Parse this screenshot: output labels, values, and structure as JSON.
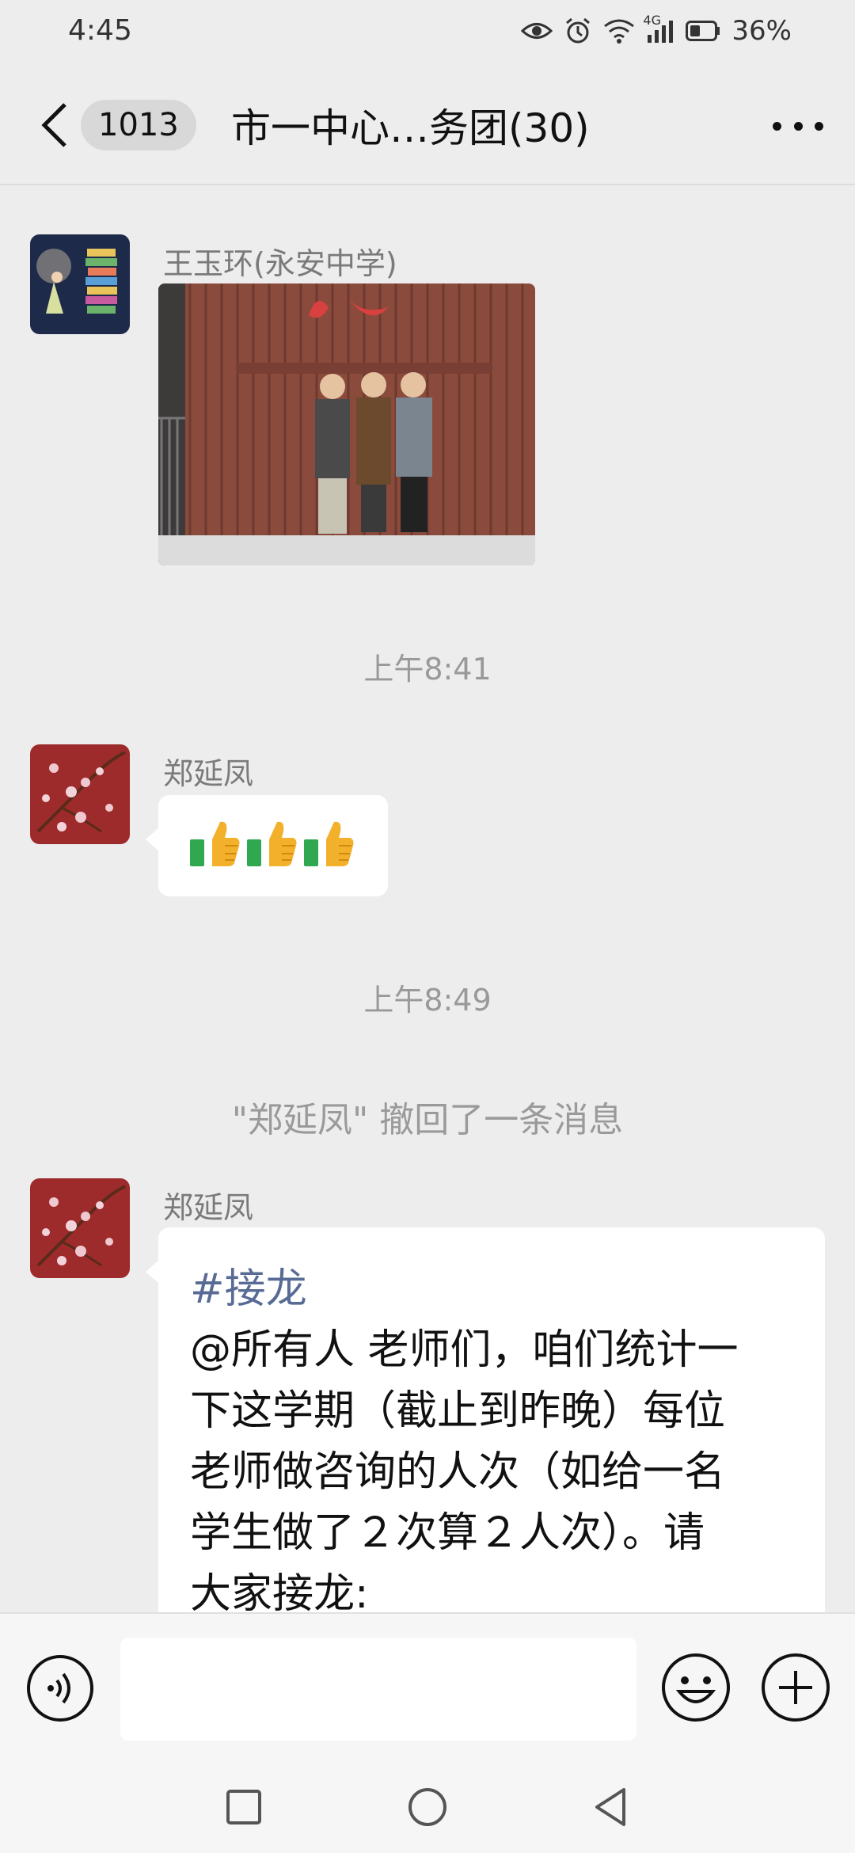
{
  "status_bar": {
    "time": "4:45",
    "network": "4G",
    "battery": "36%",
    "icons": [
      "eye-icon",
      "alarm-icon",
      "wifi-icon",
      "signal-icon",
      "battery-icon"
    ]
  },
  "header": {
    "back_icon": "chevron-left-icon",
    "unread_count": "1013",
    "title": "市一中心…务团(30)",
    "more_icon": "more-icon"
  },
  "messages": [
    {
      "type": "image",
      "sender": "王玉环(永安中学)",
      "content_icon": "photo-image"
    },
    {
      "type": "timestamp",
      "text": "上午8:41"
    },
    {
      "type": "emoji",
      "sender": "郑延凤",
      "emoji": [
        "thumbs-up-icon",
        "thumbs-up-icon",
        "thumbs-up-icon"
      ]
    },
    {
      "type": "timestamp",
      "text": "上午8:49"
    },
    {
      "type": "system",
      "text": "\"郑延凤\" 撤回了一条消息"
    },
    {
      "type": "text",
      "sender": "郑延凤",
      "hashtag": "#接龙",
      "lines": [
        "@所有人 老师们，咱们统计一",
        "下这学期（截止到昨晚）每位",
        "老师做咨询的人次（如给一名",
        "学生做了２次算２人次）。请",
        "大家接龙:"
      ]
    }
  ],
  "input_bar": {
    "voice_icon": "voice-icon",
    "input_value": "",
    "emoji_icon": "emoji-icon",
    "plus_icon": "plus-icon"
  },
  "nav_bar": {
    "icons": [
      "recent-apps-icon",
      "home-icon",
      "back-icon"
    ]
  }
}
